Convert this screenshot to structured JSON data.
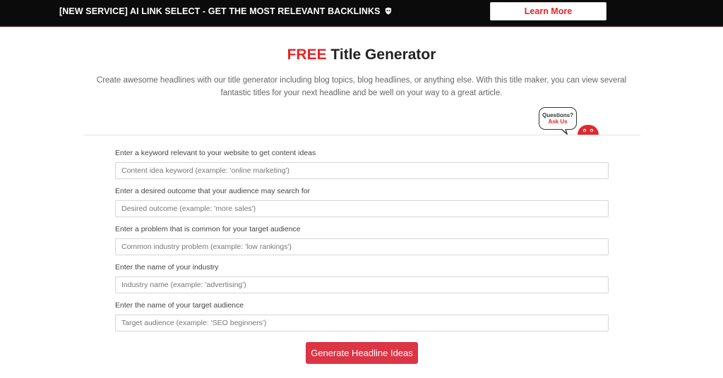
{
  "banner": {
    "text": "[NEW SERVICE] AI LINK SELECT - GET THE MOST RELEVANT BACKLINKS",
    "icon": "shield-icon",
    "cta_label": "Learn More"
  },
  "page": {
    "title_accent": "FREE",
    "title_rest": " Title Generator",
    "description": "Create awesome headlines with our title generator including blog topics, blog headlines, or anything else. With this title maker, you can view several fantastic titles for your next headline and be well on your way to a great article."
  },
  "help_widget": {
    "line1": "Questions?",
    "line2": "Ask Us"
  },
  "form": {
    "fields": [
      {
        "label": "Enter a keyword relevant to your website to get content ideas",
        "placeholder": "Content idea keyword (example: 'online marketing')",
        "value": ""
      },
      {
        "label": "Enter a desired outcome that your audience may search for",
        "placeholder": "Desired outcome (example: 'more sales')",
        "value": ""
      },
      {
        "label": "Enter a problem that is common for your target audience",
        "placeholder": "Common industry problem (example: 'low rankings')",
        "value": ""
      },
      {
        "label": "Enter the name of your industry",
        "placeholder": "Industry name (example: 'advertising')",
        "value": ""
      },
      {
        "label": "Enter the name of your target audience",
        "placeholder": "Target audience (example: 'SEO beginners')",
        "value": ""
      }
    ],
    "submit_label": "Generate Headline Ideas"
  },
  "colors": {
    "accent": "#e4262b",
    "button": "#dc3545",
    "banner_bg": "#0b0b0b"
  }
}
